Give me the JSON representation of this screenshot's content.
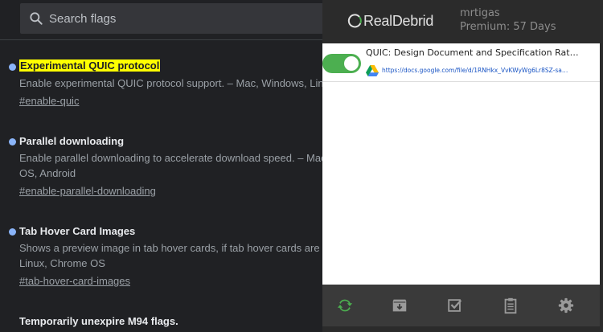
{
  "search": {
    "placeholder": "Search flags"
  },
  "flags": [
    {
      "title": "Experimental QUIC protocol",
      "description": [
        "Enable experimental QUIC protocol support. – Mac, Windows, Linux"
      ],
      "link": "#enable-quic",
      "highlighted": true
    },
    {
      "title": "Parallel downloading",
      "description": [
        "Enable parallel downloading to accelerate download speed. – Mac",
        "OS, Android"
      ],
      "link": "#enable-parallel-downloading",
      "highlighted": false
    },
    {
      "title": "Tab Hover Card Images",
      "description": [
        "Shows a preview image in tab hover cards, if tab hover cards are e",
        "Linux, Chrome OS"
      ],
      "link": "#tab-hover-card-images",
      "highlighted": false
    },
    {
      "title": "Temporarily unexpire M94 flags.",
      "description": [],
      "link": "",
      "highlighted": false
    }
  ],
  "popup": {
    "logo_text": "RealDebrid",
    "user_name": "mrtigas",
    "premium_status": "Premium: 57 Days",
    "items": [
      {
        "title": "QUIC: Design Document and Specification Ratio…",
        "url": "https://docs.google.com/file/d/1RNHkx_VvKWyWg6Lr8SZ-sa…",
        "enabled": true
      }
    ],
    "footer_icons": [
      "refresh-icon",
      "download-box-icon",
      "checklist-icon",
      "clipboard-icon",
      "gear-icon"
    ]
  },
  "colors": {
    "page_bg": "#202124",
    "highlight": "#ffff00",
    "flag_dot": "#8ab4f8",
    "toggle_on": "#4caf50",
    "refresh_icon": "#4caf50",
    "footer_icon": "#9a9a9a"
  }
}
